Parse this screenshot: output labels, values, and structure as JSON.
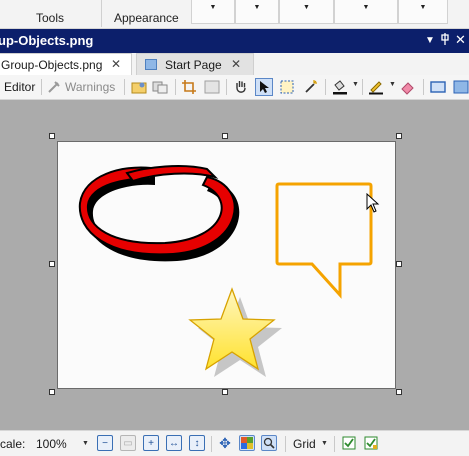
{
  "ribbon": {
    "groups": [
      {
        "label": "Tools"
      },
      {
        "label": "Appearance"
      }
    ],
    "dropdown_arrow": "▼"
  },
  "window": {
    "title": "up-Objects.png",
    "menu_icon": "chevron-down-icon",
    "pin_icon": "pin-icon",
    "close_icon": "close-icon"
  },
  "tabs": [
    {
      "label": "Group-Objects.png",
      "active": true
    },
    {
      "label": "Start Page",
      "active": false
    }
  ],
  "toolbar": {
    "editor_label": "Editor",
    "warnings_label": "Warnings",
    "tools": [
      "open-icon",
      "copy-icon",
      "crop-icon",
      "resize-icon",
      "hand-icon",
      "pointer-icon",
      "marquee-icon",
      "magic-wand-icon",
      "fill-icon",
      "pen-icon",
      "eraser-icon",
      "rectangle-icon",
      "palette-icon"
    ]
  },
  "canvas": {
    "shapes": [
      "red-ellipse-shape",
      "callout-shape",
      "star-shape"
    ],
    "colors": {
      "red": "#e60000",
      "orange": "#f5a300",
      "star": "#ffe34a",
      "selection": "#333333"
    }
  },
  "statusbar": {
    "scale_label": "cale:",
    "scale_value": "100%",
    "grid_label": "Grid",
    "buttons": [
      "zoom-out-icon",
      "zoom-actual-icon",
      "zoom-in-icon",
      "fit-width-icon",
      "fit-height-icon",
      "pan-icon",
      "checkerboard-icon",
      "zoom-tool-icon",
      "validate-icon",
      "validate-all-icon"
    ]
  }
}
